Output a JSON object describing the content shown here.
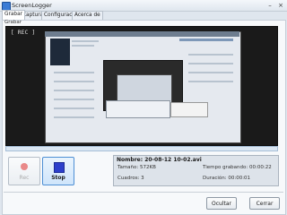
{
  "window": {
    "title": "ScreenLogger"
  },
  "tabs": [
    {
      "label": "Grabar",
      "active": true
    },
    {
      "label": "Capturas",
      "active": false
    },
    {
      "label": "Configuración",
      "active": false
    },
    {
      "label": "Acerca de",
      "active": false
    }
  ],
  "group": {
    "label": "Grabar"
  },
  "preview": {
    "status": "[  REC ]"
  },
  "controls": {
    "rec_label": "Rec",
    "stop_label": "Stop"
  },
  "info": {
    "name": "Nombre: 20-08-12 10-02.avi",
    "size": "Tamaño: 572KB",
    "frames": "Cuadros: 3",
    "time_recorded": "Tiempo grabando: 00:00:22",
    "duration": "Duración: 00:00:01"
  },
  "footer": {
    "hide_label": "Ocultar",
    "close_label": "Cerrar"
  },
  "colors": {
    "accent": "#3a7bd5",
    "stop": "#2c3fcb",
    "rec": "#e45a5a"
  }
}
